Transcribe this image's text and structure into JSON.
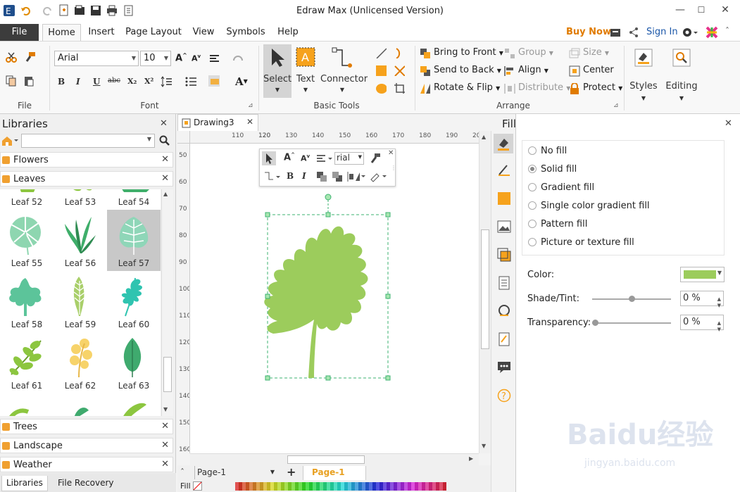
{
  "window": {
    "title": "Edraw Max (Unlicensed Version)",
    "minimize": "—",
    "maximize": "☐",
    "close": "✕"
  },
  "menu": {
    "file": "File",
    "tabs": [
      "Home",
      "Insert",
      "Page Layout",
      "View",
      "Symbols",
      "Help"
    ],
    "buy_now": "Buy Now",
    "sign_in": "Sign In"
  },
  "ribbon": {
    "file_group": {
      "label": "File"
    },
    "font_group": {
      "label": "Font",
      "font_name": "Arial",
      "font_size": "10",
      "buttons": [
        "B",
        "I",
        "U",
        "abc",
        "X₂",
        "X²"
      ]
    },
    "basic_tools": {
      "label": "Basic Tools",
      "select": "Select",
      "text": "Text",
      "connector": "Connector"
    },
    "arrange": {
      "label": "Arrange",
      "bring_to_front": "Bring to Front",
      "send_to_back": "Send to Back",
      "rotate_flip": "Rotate & Flip",
      "group": "Group",
      "align": "Align",
      "distribute": "Distribute",
      "size": "Size",
      "center": "Center",
      "protect": "Protect"
    },
    "styles": "Styles",
    "editing": "Editing"
  },
  "libraries": {
    "title": "Libraries",
    "categories_top": [
      "Flowers",
      "Leaves"
    ],
    "categories_bottom": [
      "Trees",
      "Landscape",
      "Weather"
    ],
    "partial_row": [
      "Leaf 52",
      "Leaf 53",
      "Leaf 54"
    ],
    "shapes": [
      {
        "label": "Leaf 55",
        "color": "#8ed6b0"
      },
      {
        "label": "Leaf 56",
        "color": "#3fae6a"
      },
      {
        "label": "Leaf 57",
        "color": "#8fd6b8",
        "selected": true
      },
      {
        "label": "Leaf 58",
        "color": "#5cc49a"
      },
      {
        "label": "Leaf 59",
        "color": "#a9cf6a"
      },
      {
        "label": "Leaf 60",
        "color": "#2fc4b0"
      },
      {
        "label": "Leaf 61",
        "color": "#8cc63f"
      },
      {
        "label": "Leaf 62",
        "color": "#f7d36a"
      },
      {
        "label": "Leaf 63",
        "color": "#3faa6e"
      }
    ],
    "bottom_tabs": [
      "Libraries",
      "File Recovery"
    ]
  },
  "document": {
    "tab": "Drawing3",
    "ruler_top": [
      "120",
      "110",
      "120",
      "130",
      "140",
      "150",
      "160",
      "170",
      "180",
      "190",
      "200"
    ],
    "ruler_left": [
      "50",
      "60",
      "70",
      "80",
      "90",
      "100",
      "110",
      "120",
      "130",
      "140",
      "150",
      "160"
    ],
    "page_dropdown": "Page-1",
    "page_tab": "Page-1",
    "fill_label": "Fill",
    "mini_font": "rial",
    "leaf_color": "#9ccc5c"
  },
  "fill_panel": {
    "title": "Fill",
    "options": [
      "No fill",
      "Solid fill",
      "Gradient fill",
      "Single color gradient fill",
      "Pattern fill",
      "Picture or texture fill"
    ],
    "selected_option": "Solid fill",
    "color_label": "Color:",
    "color_value": "#9ccc5c",
    "shade_label": "Shade/Tint:",
    "shade_value": "0 %",
    "transparency_label": "Transparency:",
    "transparency_value": "0 %"
  },
  "watermark": {
    "text": "Baidu经验",
    "sub": "jingyan.baidu.com"
  }
}
